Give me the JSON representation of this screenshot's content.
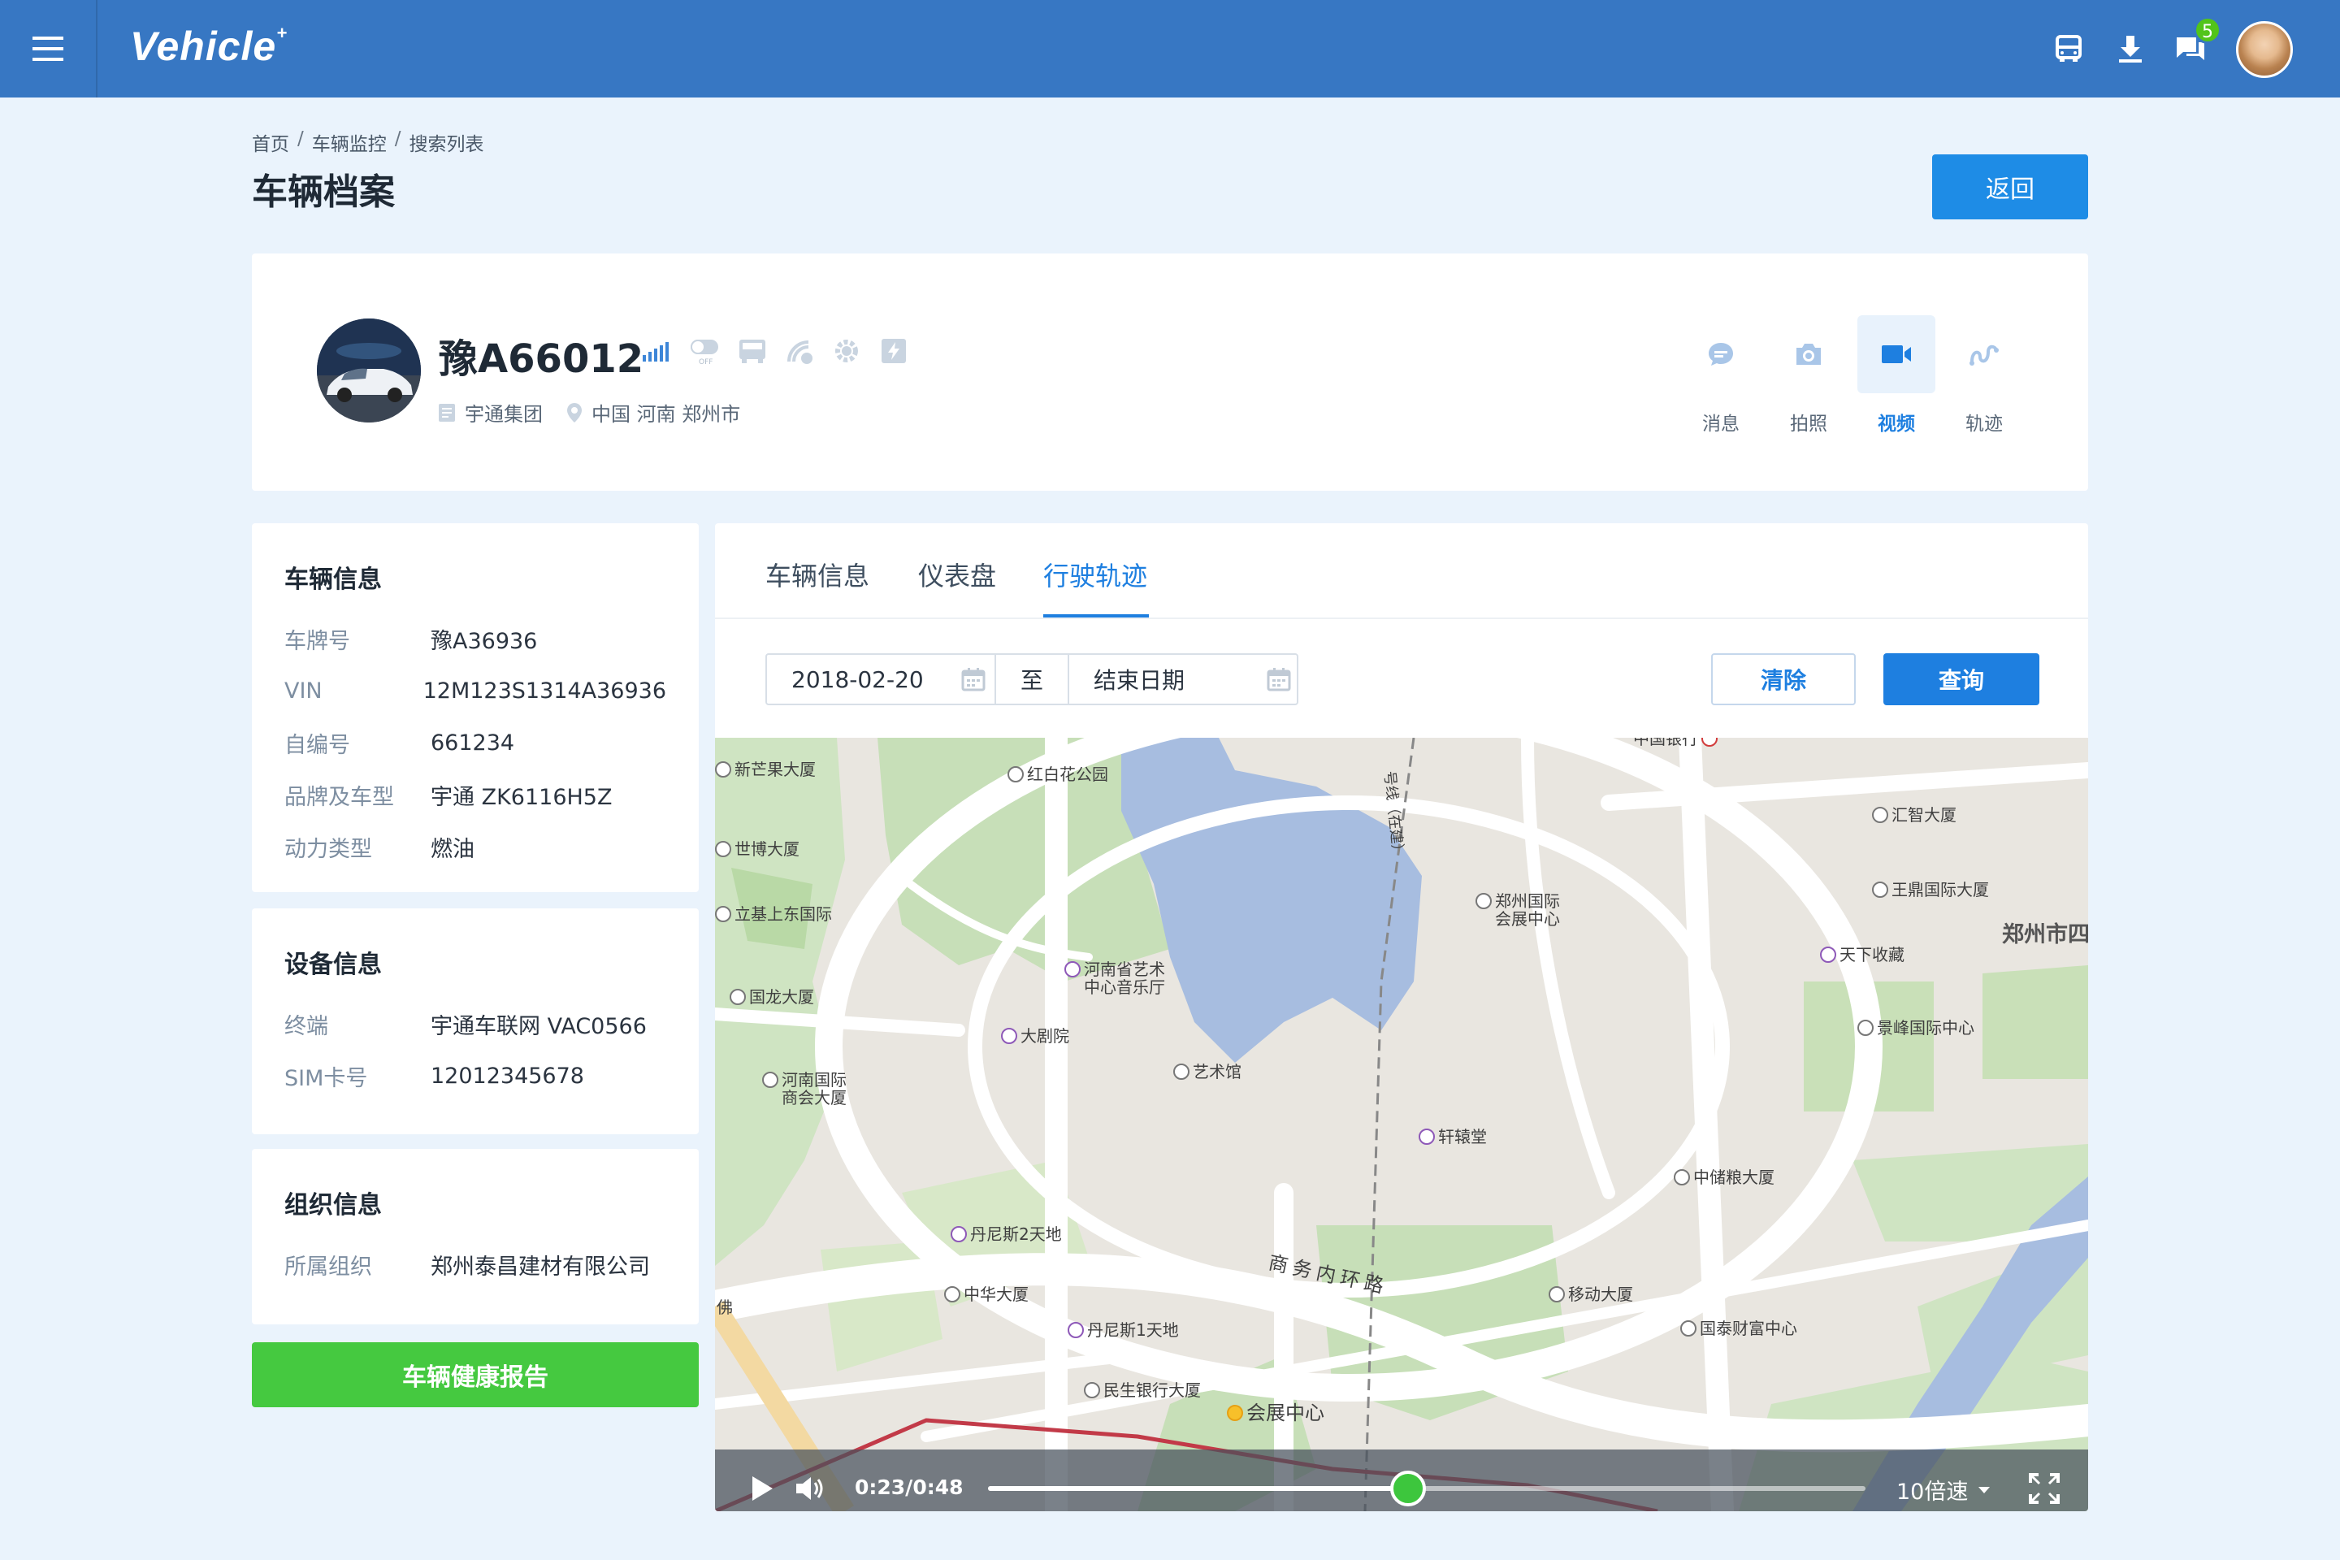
{
  "app": {
    "name": "Vehicle",
    "logo_mark": "+"
  },
  "topbar": {
    "message_badge": "5",
    "icons": [
      "menu-icon",
      "bus-icon",
      "download-icon",
      "chat-icon",
      "avatar"
    ]
  },
  "breadcrumb": {
    "items": [
      "首页",
      "车辆监控",
      "搜索列表"
    ],
    "separator": "/"
  },
  "page": {
    "title": "车辆档案",
    "back_label": "返回"
  },
  "profile": {
    "plate": "豫A66012",
    "organization": "宇通集团",
    "location": "中国 河南 郑州市",
    "status_icons": [
      "signal-icon",
      "switch-off-icon",
      "bus-front-icon",
      "satellite-icon",
      "gear-icon",
      "charge-icon"
    ],
    "actions": [
      {
        "label": "消息",
        "icon": "message-icon",
        "active": false
      },
      {
        "label": "拍照",
        "icon": "camera-icon",
        "active": false
      },
      {
        "label": "视频",
        "icon": "video-icon",
        "active": true
      },
      {
        "label": "轨迹",
        "icon": "track-icon",
        "active": false
      }
    ]
  },
  "vehicle_info": {
    "title": "车辆信息",
    "rows": [
      {
        "k": "车牌号",
        "v": "豫A36936"
      },
      {
        "k": "VIN",
        "v": "12M123S1314A36936"
      },
      {
        "k": "自编号",
        "v": "661234"
      },
      {
        "k": "品牌及车型",
        "v": "宇通 ZK6116H5Z"
      },
      {
        "k": "动力类型",
        "v": "燃油"
      }
    ]
  },
  "device_info": {
    "title": "设备信息",
    "rows": [
      {
        "k": "终端",
        "v": "宇通车联网 VAC0566"
      },
      {
        "k": "SIM卡号",
        "v": "12012345678"
      }
    ]
  },
  "org_info": {
    "title": "组织信息",
    "rows": [
      {
        "k": "所属组织",
        "v": "郑州泰昌建材有限公司"
      }
    ]
  },
  "health_report_label": "车辆健康报告",
  "tabs": [
    {
      "label": "车辆信息",
      "active": false
    },
    {
      "label": "仪表盘",
      "active": false
    },
    {
      "label": "行驶轨迹",
      "active": true
    }
  ],
  "filter": {
    "start_date": "2018-02-20",
    "to_label": "至",
    "end_placeholder": "结束日期",
    "clear_label": "清除",
    "query_label": "查询"
  },
  "map": {
    "pois": {
      "p1": "新芒果大厦",
      "p2": "红白花公园",
      "p3": "世博大厦",
      "p4": "立基上东国际",
      "p5a": "郑州国际",
      "p5b": "会展中心",
      "p6": "汇智大厦",
      "p7": "王鼎国际大厦",
      "p8": "天下收藏",
      "p9": "郑州市四",
      "p10a": "河南省艺术",
      "p10b": "中心音乐厅",
      "p11": "国龙大厦",
      "p12": "大剧院",
      "p13": "景峰国际中心",
      "p14a": "河南国际",
      "p14b": "商会大厦",
      "p15": "艺术馆",
      "p16": "轩辕堂",
      "p17": "中储粮大厦",
      "p18": "丹尼斯2天地",
      "p19": "商务内环路",
      "p20": "中华大厦",
      "p21": "移动大厦",
      "p22": "丹尼斯1天地",
      "p23": "国泰财富中心",
      "p24": "民生银行大厦",
      "p25": "会展中心",
      "p26": "号线（在建）",
      "p27": "中国银行",
      "p28": "佛"
    }
  },
  "player": {
    "time": "0:23/0:48",
    "progress": 0.479,
    "speed_label": "10倍速"
  },
  "colors": {
    "topbar": "#3777c3",
    "primary": "#1e7fe0",
    "success": "#45c940",
    "knob": "#3dc63d"
  }
}
